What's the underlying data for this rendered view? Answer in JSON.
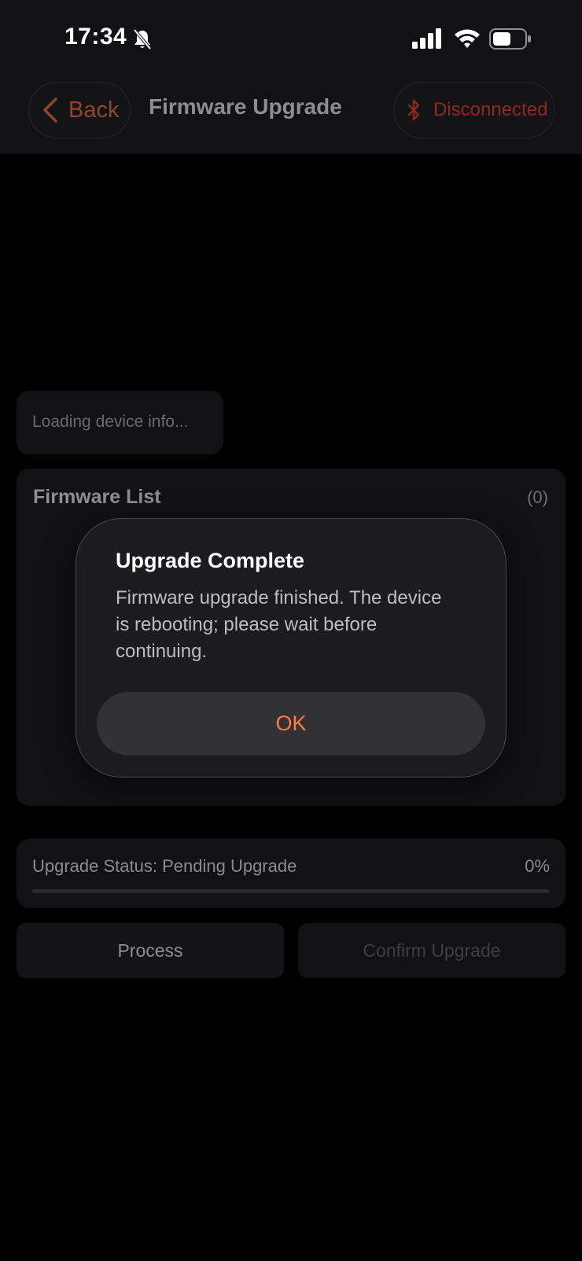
{
  "status_bar": {
    "time": "17:34",
    "icons": [
      "bell-slash-icon",
      "signal-icon",
      "wifi-icon",
      "battery-icon"
    ]
  },
  "nav": {
    "back_label": "Back",
    "title": "Firmware Upgrade",
    "connection_label": "Disconnected"
  },
  "device_info": {
    "loading_text": "Loading device info..."
  },
  "firmware_list": {
    "title": "Firmware List",
    "count": "(0)"
  },
  "upgrade_status": {
    "text": "Upgrade Status: Pending Upgrade",
    "percent": "0%",
    "progress": 0
  },
  "buttons": {
    "process": "Process",
    "confirm": "Confirm Upgrade"
  },
  "dialog": {
    "title": "Upgrade Complete",
    "message": "Firmware upgrade finished. The device is rebooting; please wait before continuing.",
    "ok_label": "OK"
  },
  "colors": {
    "accent": "#ff7a45",
    "back": "#8f4630",
    "disconnected": "#8c2a22",
    "background": "#000000",
    "card": "#121214"
  }
}
